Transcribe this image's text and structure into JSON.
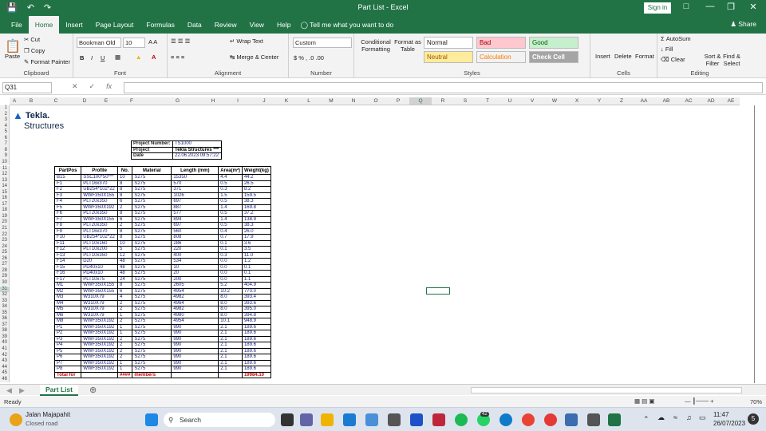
{
  "app": {
    "title": "Part List  -  Excel",
    "signin": "Sign in",
    "share": "Share"
  },
  "tabs": [
    "File",
    "Home",
    "Insert",
    "Page Layout",
    "Formulas",
    "Data",
    "Review",
    "View",
    "Help"
  ],
  "tell_me": "Tell me what you want to do",
  "ribbon": {
    "clipboard": {
      "paste": "Paste",
      "cut": "Cut",
      "copy": "Copy",
      "format_painter": "Format Painter",
      "label": "Clipboard"
    },
    "font": {
      "name": "Bookman Old",
      "size": "10",
      "label": "Font"
    },
    "alignment": {
      "wrap": "Wrap Text",
      "merge": "Merge & Center",
      "label": "Alignment"
    },
    "number": {
      "format": "Custom",
      "label": "Number"
    },
    "styles": {
      "conditional": "Conditional Formatting",
      "format_table": "Format as Table",
      "normal": "Normal",
      "bad": "Bad",
      "good": "Good",
      "neutral": "Neutral",
      "calculation": "Calculation",
      "check_cell": "Check Cell",
      "label": "Styles"
    },
    "cells": {
      "insert": "Insert",
      "delete": "Delete",
      "format": "Format",
      "label": "Cells"
    },
    "editing": {
      "autosum": "AutoSum",
      "fill": "Fill",
      "clear": "Clear",
      "sort": "Sort & Filter",
      "find": "Find & Select",
      "label": "Editing"
    }
  },
  "formula_bar": {
    "name_box": "Q31",
    "value": ""
  },
  "columns": [
    "A",
    "B",
    "C",
    "D",
    "E",
    "F",
    "G",
    "H",
    "I",
    "J",
    "K",
    "L",
    "M",
    "N",
    "O",
    "P",
    "Q",
    "R",
    "S",
    "T",
    "U",
    "V",
    "W",
    "X",
    "Y",
    "Z",
    "AA",
    "AB",
    "AC",
    "AD",
    "AE"
  ],
  "logo": {
    "line1": "Tekla.",
    "line2": "Structures"
  },
  "project": [
    {
      "label": "Project Number:",
      "value": "TS1000"
    },
    {
      "label": "Project",
      "value": "Tekla Structures ***"
    },
    {
      "label": "Date",
      "value": "22.06.2023 09:57:22"
    }
  ],
  "parts_header": [
    "PartPos",
    "Profile",
    "No.",
    "Material",
    "Length (mm)",
    "Area(m²)",
    "Weight(kg)"
  ],
  "parts": [
    [
      "B15",
      "SSC100*50***",
      "10",
      "S275",
      "15350",
      "4.4",
      "44.2"
    ],
    [
      "F1",
      "PLT16x370",
      "8",
      "S275",
      "570",
      "0.5",
      "26.5"
    ],
    [
      "F2",
      "UB254*102*22",
      "8",
      "S275",
      "371",
      "0.3",
      "8.2"
    ],
    [
      "F3",
      "WWF350X155",
      "8",
      "S275",
      "1026",
      "1.5",
      "159.5"
    ],
    [
      "F4",
      "PLT20x350",
      "6",
      "S275",
      "697",
      "0.5",
      "38.3"
    ],
    [
      "F5",
      "WWF350X192",
      "2",
      "S275",
      "887",
      "1.4",
      "169.8"
    ],
    [
      "F6",
      "PLT20x350",
      "8",
      "S275",
      "577",
      "0.5",
      "37.2"
    ],
    [
      "F7",
      "WWF350X155",
      "6",
      "S275",
      "894",
      "1.4",
      "138.9"
    ],
    [
      "F8",
      "PLT20x350",
      "2",
      "S275",
      "697",
      "0.5",
      "38.3"
    ],
    [
      "F9",
      "PLT16x370",
      "8",
      "S275",
      "560",
      "0.4",
      "26.0"
    ],
    [
      "F10",
      "UB254*102*22",
      "8",
      "S275",
      "808",
      "0.7",
      "17.9"
    ],
    [
      "F11",
      "PLT10x160",
      "10",
      "S275",
      "286",
      "0.1",
      "3.6"
    ],
    [
      "F12",
      "PLT10x200",
      "5",
      "S275",
      "220",
      "0.1",
      "3.5"
    ],
    [
      "F13",
      "PLT10x350",
      "12",
      "S275",
      "400",
      "0.3",
      "11.0"
    ],
    [
      "F14",
      "D20",
      "48",
      "S275",
      "534",
      "0.0",
      "1.2"
    ],
    [
      "F15",
      "PD40x10",
      "48",
      "S275",
      "10",
      "0.0",
      "0.1"
    ],
    [
      "F16",
      "PD40x10",
      "48",
      "S275",
      "20",
      "0.0",
      "0.1"
    ],
    [
      "F17",
      "PLT10x75",
      "24",
      "S275",
      "200",
      "0.0",
      "1.1"
    ],
    [
      "M1",
      "WWF350X155",
      "8",
      "S275",
      "2605",
      "5.2",
      "404.9"
    ],
    [
      "M2",
      "WWF350X155",
      "6",
      "S275",
      "4954",
      "10.2",
      "770.0"
    ],
    [
      "M3",
      "W310X79",
      "4",
      "S275",
      "4982",
      "8.0",
      "393.4"
    ],
    [
      "M4",
      "W310X79",
      "2",
      "S275",
      "4964",
      "8.0",
      "393.6"
    ],
    [
      "M5",
      "W310X79",
      "2",
      "S275",
      "4982",
      "8.0",
      "395.0"
    ],
    [
      "M6",
      "W310X79",
      "1",
      "S275",
      "4980",
      "8.0",
      "394.8"
    ],
    [
      "M8",
      "WWF350X192",
      "2",
      "S275",
      "4954",
      "10.1",
      "948.9"
    ],
    [
      "P1",
      "WWF350X192",
      "1",
      "S275",
      "990",
      "2.1",
      "189.6"
    ],
    [
      "P2",
      "WWF350X192",
      "1",
      "S275",
      "990",
      "2.1",
      "189.6"
    ],
    [
      "P3",
      "WWF350X192",
      "2",
      "S275",
      "990",
      "2.1",
      "189.6"
    ],
    [
      "P4",
      "WWF350X192",
      "2",
      "S275",
      "990",
      "2.1",
      "189.6"
    ],
    [
      "P5",
      "WWF350X192",
      "2",
      "S275",
      "990",
      "2.1",
      "189.6"
    ],
    [
      "P6",
      "WWF350X192",
      "2",
      "S275",
      "990",
      "2.1",
      "189.6"
    ],
    [
      "P7",
      "WWF350X192",
      "1",
      "S275",
      "990",
      "2.1",
      "189.6"
    ],
    [
      "P8",
      "WWF350X192",
      "1",
      "S275",
      "990",
      "2.1",
      "189.6"
    ]
  ],
  "total_row": [
    "Total for",
    "",
    "####",
    "members",
    "",
    "",
    "19984.10"
  ],
  "sheet_tab": "Part List",
  "status": {
    "ready": "Ready",
    "zoom": "70%"
  },
  "taskbar": {
    "weather_title": "Jalan Majapahit",
    "weather_sub": "Closed road",
    "search": "Search",
    "time": "11:47",
    "date": "26/07/2023",
    "badge": "42"
  },
  "colors": {
    "excel_green": "#217346",
    "part_text": "#1a237e",
    "total_text": "#cc0000"
  }
}
